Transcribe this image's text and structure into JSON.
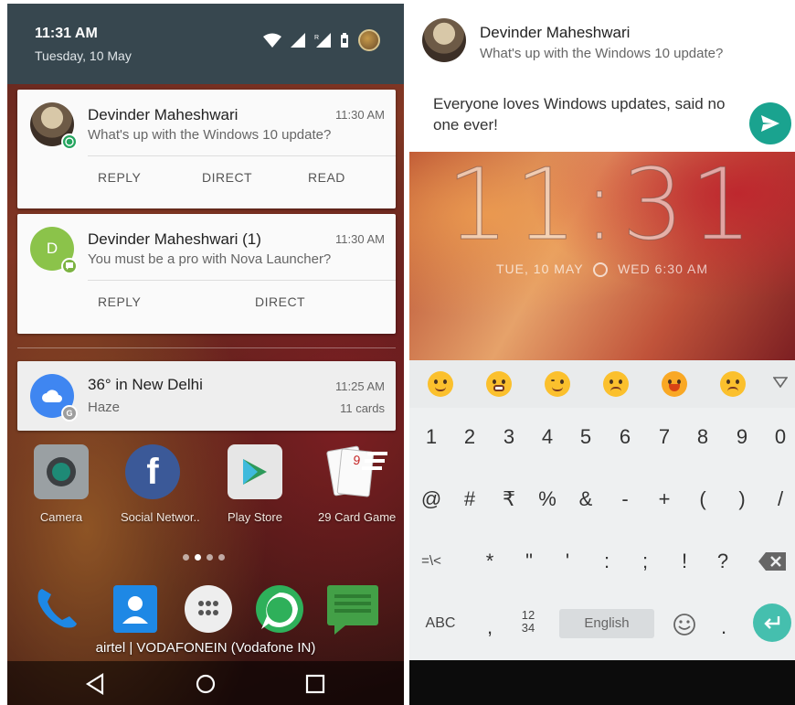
{
  "left_phone": {
    "status_bar": {
      "time": "11:31 AM",
      "date": "Tuesday, 10 May"
    },
    "notifications": [
      {
        "name": "Devinder Maheshwari",
        "message": "What's up with the Windows 10 update?",
        "time": "11:30 AM",
        "actions": [
          "REPLY",
          "DIRECT",
          "READ"
        ]
      },
      {
        "avatar_letter": "D",
        "name": "Devinder Maheshwari (1)",
        "message": "You must be a pro with Nova Launcher?",
        "time": "11:30 AM",
        "actions": [
          "REPLY",
          "DIRECT"
        ]
      },
      {
        "name": "36° in New Delhi",
        "message": "Haze",
        "time": "11:25 AM",
        "meta": "11 cards"
      }
    ],
    "home_apps": [
      "Camera",
      "Social Networ..",
      "Play Store",
      "29 Card Game"
    ],
    "carrier": "airtel | VODAFONEIN (Vodafone IN)"
  },
  "right_phone": {
    "notification": {
      "name": "Devinder Maheshwari",
      "message": "What's up with the Windows 10 update?"
    },
    "reply_text": "Everyone loves Windows updates, said no one ever!",
    "lockscreen": {
      "clock": "11:31",
      "date": "TUE, 10 MAY",
      "alarm": "WED 6:30 AM"
    },
    "keyboard": {
      "row1": [
        "1",
        "2",
        "3",
        "4",
        "5",
        "6",
        "7",
        "8",
        "9",
        "0"
      ],
      "row2": [
        "@",
        "#",
        "₹",
        "%",
        "&",
        "-",
        "+",
        "(",
        ")",
        "/"
      ],
      "row3": [
        "=\\<",
        "*",
        "\"",
        "'",
        ":",
        ";",
        "!",
        "?"
      ],
      "abc": "ABC",
      "comma": ",",
      "num_switch_top": "12",
      "num_switch_bottom": "34",
      "space_label": "English",
      "period": "."
    }
  },
  "colors": {
    "status_bar": "#37474f",
    "accent_teal": "#1aa38f",
    "whatsapp_green": "#25a55f",
    "weather_blue": "#3f86f1",
    "contact_green": "#8bc34a"
  }
}
